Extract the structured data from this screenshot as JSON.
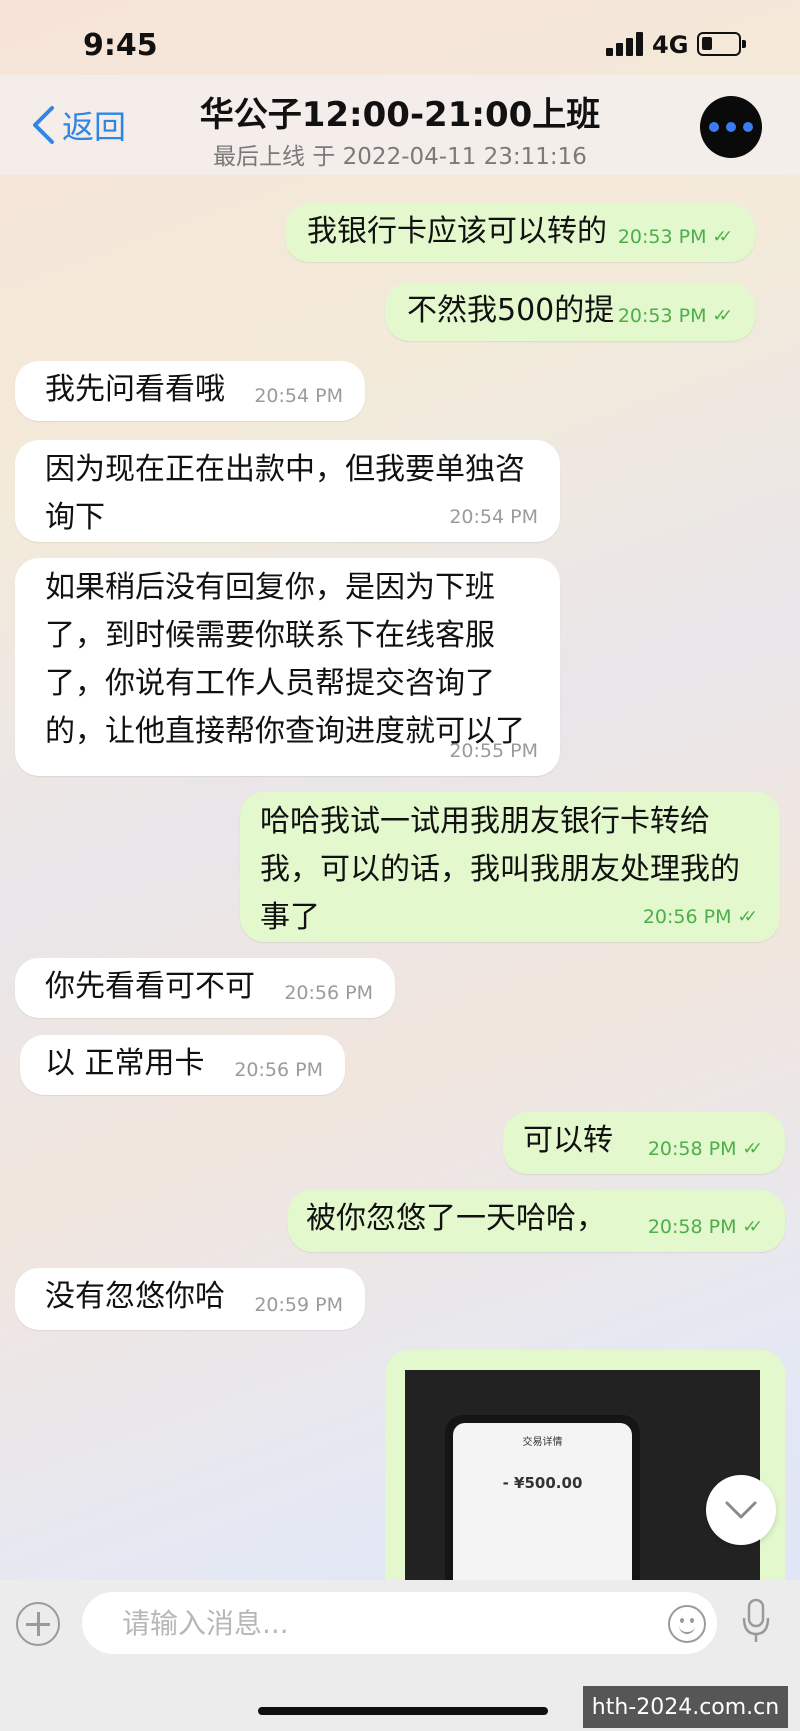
{
  "status": {
    "time": "9:45",
    "network": "4G"
  },
  "header": {
    "back_label": "返回",
    "title": "华公子12:00-21:00上班",
    "subtitle": "最后上线 于 2022-04-11 23:11:16"
  },
  "messages": [
    {
      "from": "me",
      "text": "我银行卡应该可以转的",
      "time": "20:53 PM"
    },
    {
      "from": "me",
      "text": "不然我500的提",
      "time": "20:53 PM"
    },
    {
      "from": "them",
      "text": "我先问看看哦",
      "time": "20:54 PM"
    },
    {
      "from": "them",
      "text": "因为现在正在出款中，但我要单独咨\n询下",
      "time": "20:54 PM"
    },
    {
      "from": "them",
      "text": "如果稍后没有回复你，是因为下班\n了，到时候需要你联系下在线客服\n了，你说有工作人员帮提交咨询了\n的，让他直接帮你查询进度就可以了",
      "time": "20:55 PM"
    },
    {
      "from": "me",
      "text": "哈哈我试一试用我朋友银行卡转给\n我，可以的话，我叫我朋友处理我的\n事了",
      "time": "20:56 PM"
    },
    {
      "from": "them",
      "text": "你先看看可不可",
      "time": "20:56 PM"
    },
    {
      "from": "them",
      "text": "以 正常用卡",
      "time": "20:56 PM"
    },
    {
      "from": "me",
      "text": "可以转",
      "time": "20:58 PM"
    },
    {
      "from": "me",
      "text": "被你忽悠了一天哈哈，",
      "time": "20:58 PM"
    },
    {
      "from": "them",
      "text": "没有忽悠你哈",
      "time": "20:59 PM"
    }
  ],
  "photo": {
    "screen_title": "交易详情",
    "amount": "- ¥500.00"
  },
  "composer": {
    "placeholder": "请输入消息..."
  },
  "watermark": "hth-2024.com.cn"
}
